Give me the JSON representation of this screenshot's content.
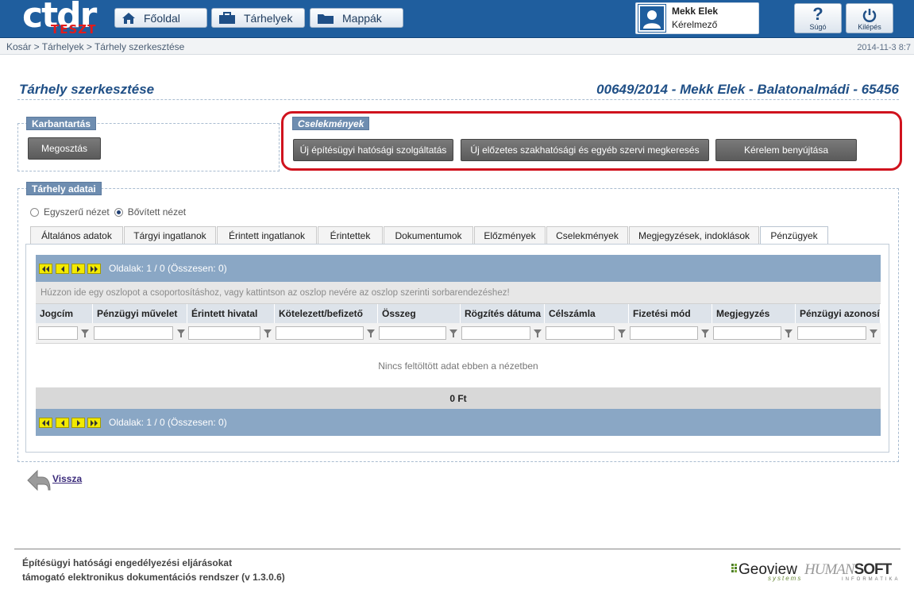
{
  "header": {
    "logo_text": "ctdr",
    "logo_badge": "TESZT",
    "nav": [
      {
        "label": "Főoldal",
        "icon": "home-icon"
      },
      {
        "label": "Tárhelyek",
        "icon": "briefcase-icon"
      },
      {
        "label": "Mappák",
        "icon": "folder-icon"
      }
    ],
    "user": {
      "name": "Mekk Elek",
      "role": "Kérelmező"
    },
    "help_label": "Súgó",
    "logout_label": "Kilépés"
  },
  "breadcrumb": "Kosár > Tárhelyek > Tárhely szerkesztése",
  "datetime": "2014-11-3 8:7",
  "page_title": "Tárhely szerkesztése",
  "case_title": "00649/2014 - Mekk Elek - Balatonalmádi - 65456",
  "karbantartas": {
    "legend": "Karbantartás",
    "share_button": "Megosztás"
  },
  "cselekmenyek": {
    "legend": "Cselekmények",
    "buttons": [
      "Új építésügyi hatósági szolgáltatás",
      "Új előzetes szakhatósági és egyéb szervi megkeresés",
      "Kérelem benyújtása"
    ]
  },
  "tarhely_adatai": {
    "legend": "Tárhely adatai",
    "view_simple": "Egyszerű nézet",
    "view_extended": "Bővített nézet",
    "selected_view": "Bővített nézet",
    "tabs": [
      "Általános adatok",
      "Tárgyi ingatlanok",
      "Érintett ingatlanok",
      "Érintettek",
      "Dokumentumok",
      "Előzmények",
      "Cselekmények",
      "Megjegyzések, indoklások",
      "Pénzügyek"
    ],
    "active_tab": "Pénzügyek"
  },
  "grid": {
    "pager_text": "Oldalak: 1 / 0 (Összesen: 0)",
    "group_hint": "Húzzon ide egy oszlopot a csoportosításhoz, vagy kattintson az oszlop nevére az oszlop szerinti sorbarendezéshez!",
    "columns": [
      "Jogcím",
      "Pénzügyi művelet",
      "Érintett hivatal",
      "Kötelezett/befizető",
      "Összeg",
      "Rögzítés dátuma",
      "Célszámla",
      "Fizetési mód",
      "Megjegyzés",
      "Pénzügyi azonosító"
    ],
    "empty_message": "Nincs feltöltött adat ebben a nézetben",
    "sum": "0 Ft"
  },
  "back_label": "Vissza",
  "footer": {
    "line1": "Építésügyi hatósági engedélyezési eljárásokat",
    "line2": "támogató elektronikus dokumentációs rendszer (v 1.3.0.6)",
    "brand1": "Geoview",
    "brand1_sub": "systems",
    "brand2_a": "HUMAN",
    "brand2_b": "SOFT",
    "brand2_sub": "INFORMATIKA"
  },
  "colors": {
    "header_bg": "#1f5e9e",
    "legend_bg": "#6e8db0",
    "pager_bg": "#8aa7c5",
    "highlight": "#d0131e"
  }
}
